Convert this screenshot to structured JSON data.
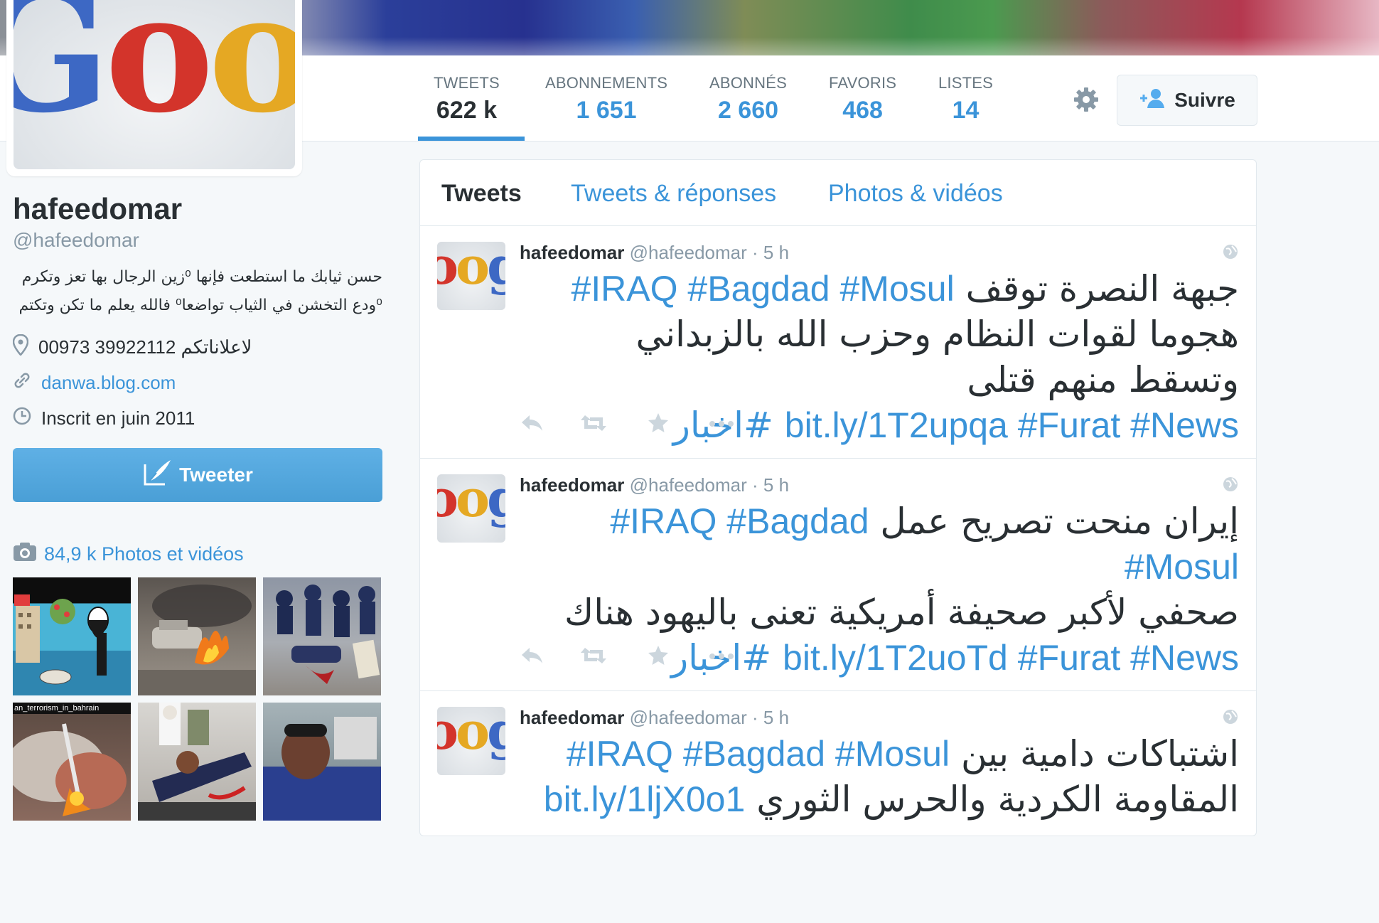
{
  "profile": {
    "name": "hafeedomar",
    "handle": "@hafeedomar",
    "bio_line1": "حسن ثيابك ما استطعت فإنها ⁰زين الرجال بها تعز وتكرم",
    "bio_line2": "⁰ودع التخشن في الثياب تواضعا⁰ فالله يعلم ما تكن وتكتم",
    "location": "00973 39922112 لاعلاناتكم",
    "website": "danwa.blog.com",
    "joined": "Inscrit en juin 2011",
    "avatar_text": "Google"
  },
  "stats": [
    {
      "label": "TWEETS",
      "value": "622 k"
    },
    {
      "label": "ABONNEMENTS",
      "value": "1 651"
    },
    {
      "label": "ABONNÉS",
      "value": "2 660"
    },
    {
      "label": "FAVORIS",
      "value": "468"
    },
    {
      "label": "LISTES",
      "value": "14"
    }
  ],
  "follow_label": "Suivre",
  "tweet_button_label": "Tweeter",
  "photos_label": "84,9 k Photos et vidéos",
  "thumbs": [
    {
      "caption": ""
    },
    {
      "caption": ""
    },
    {
      "caption": ""
    },
    {
      "caption": "an_terrorism_in_bahrain"
    },
    {
      "caption": ""
    },
    {
      "caption": ""
    }
  ],
  "tabs": [
    "Tweets",
    "Tweets & réponses",
    "Photos & vidéos"
  ],
  "tweets": [
    {
      "name": "hafeedomar",
      "handle": "@hafeedomar",
      "dot": "·",
      "time": "5 h",
      "line1_hashtags": "#IRAQ #Bagdad #Mosul",
      "line1_text": "جبهة النصرة توقف",
      "line2_text": "هجوما لقوات النظام وحزب الله بالزبداني وتسقط منهم قتلى",
      "line3_tags": "bit.ly/1T2upqa #Furat #News",
      "line3_tail": "#اخبار"
    },
    {
      "name": "hafeedomar",
      "handle": "@hafeedomar",
      "dot": "·",
      "time": "5 h",
      "line1_hashtags": "#IRAQ #Bagdad #Mosul",
      "line1_text": "إيران منحت تصريح عمل",
      "line2_text": "صحفي لأكبر صحيفة أمريكية تعنى باليهود هناك",
      "line3_tags": "bit.ly/1T2uoTd #Furat #News",
      "line3_tail": "#اخبار"
    },
    {
      "name": "hafeedomar",
      "handle": "@hafeedomar",
      "dot": "·",
      "time": "5 h",
      "line1_hashtags": "#IRAQ #Bagdad #Mosul",
      "line1_text": "اشتباكات دامية بين",
      "line2_text": "المقاومة الكردية والحرس الثوري",
      "line2_link": "bit.ly/1ljX0o1"
    }
  ]
}
